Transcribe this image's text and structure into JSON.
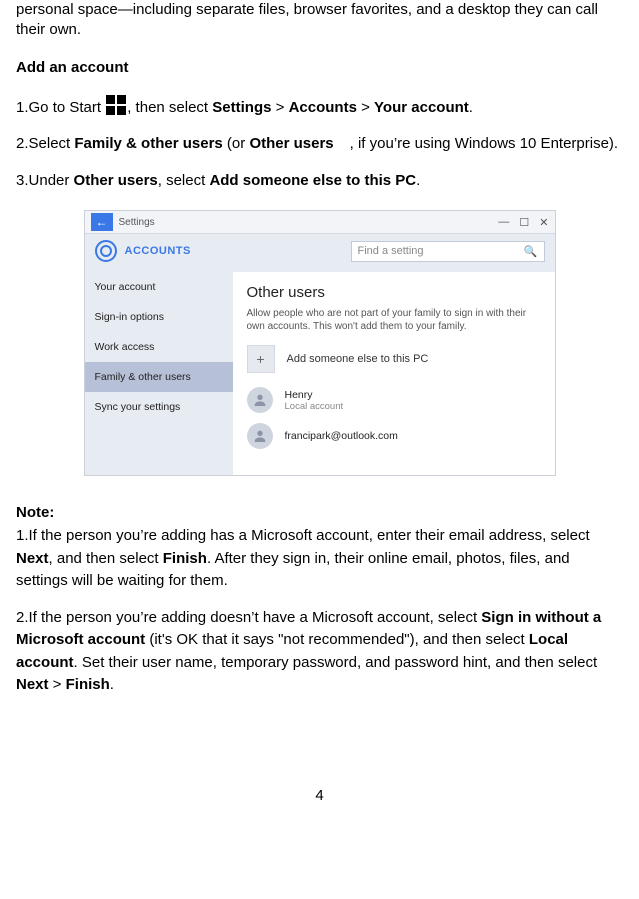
{
  "intro_text": "personal space—including separate files, browser favorites, and a desktop they can call their own.",
  "heading_add_account": "Add an account",
  "steps": {
    "s1_a": "Go to Start ",
    "s1_b": ", then select ",
    "s1_settings": "Settings",
    "s1_gt1": " > ",
    "s1_accounts": "Accounts",
    "s1_gt2": " > ",
    "s1_your_account": "Your account",
    "s1_period": ".",
    "s2_a": "Select ",
    "s2_family": "Family & other users",
    "s2_b": " (or ",
    "s2_other": "Other users",
    "s2_c": ", if you’re using Windows 10 Enterprise).",
    "s3_a": "Under ",
    "s3_other": "Other users",
    "s3_b": ", select ",
    "s3_add": "Add someone else to this PC",
    "s3_period": "."
  },
  "note_heading": "Note:",
  "notes": {
    "n1_a": "If the person you’re adding has a Microsoft account, enter their email address, select ",
    "n1_next": "Next",
    "n1_b": ", and then select ",
    "n1_finish": "Finish",
    "n1_c": ". After they sign in, their online email, photos, files, and settings will be waiting for them.",
    "n2_a": "If the person you’re adding doesn’t have a Microsoft account, select ",
    "n2_signin": "Sign in without a Microsoft account",
    "n2_b": " (it's OK that it says \"not recommended\"), and then select ",
    "n2_local": "Local account",
    "n2_c": ". Set their user name, temporary password, and password hint, and then select ",
    "n2_next": "Next",
    "n2_gt": " > ",
    "n2_finish": "Finish",
    "n2_period": "."
  },
  "settings": {
    "window_title": "Settings",
    "header_label": "ACCOUNTS",
    "search_placeholder": "Find a setting",
    "sidebar": [
      "Your account",
      "Sign-in options",
      "Work access",
      "Family & other users",
      "Sync your settings"
    ],
    "content_heading": "Other users",
    "content_desc": "Allow people who are not part of your family to sign in with their own accounts. This won't add them to your family.",
    "add_label": "Add someone else to this PC",
    "user1_name": "Henry",
    "user1_sub": "Local account",
    "user2_name": "francipark@outlook.com"
  },
  "page_number": "4"
}
